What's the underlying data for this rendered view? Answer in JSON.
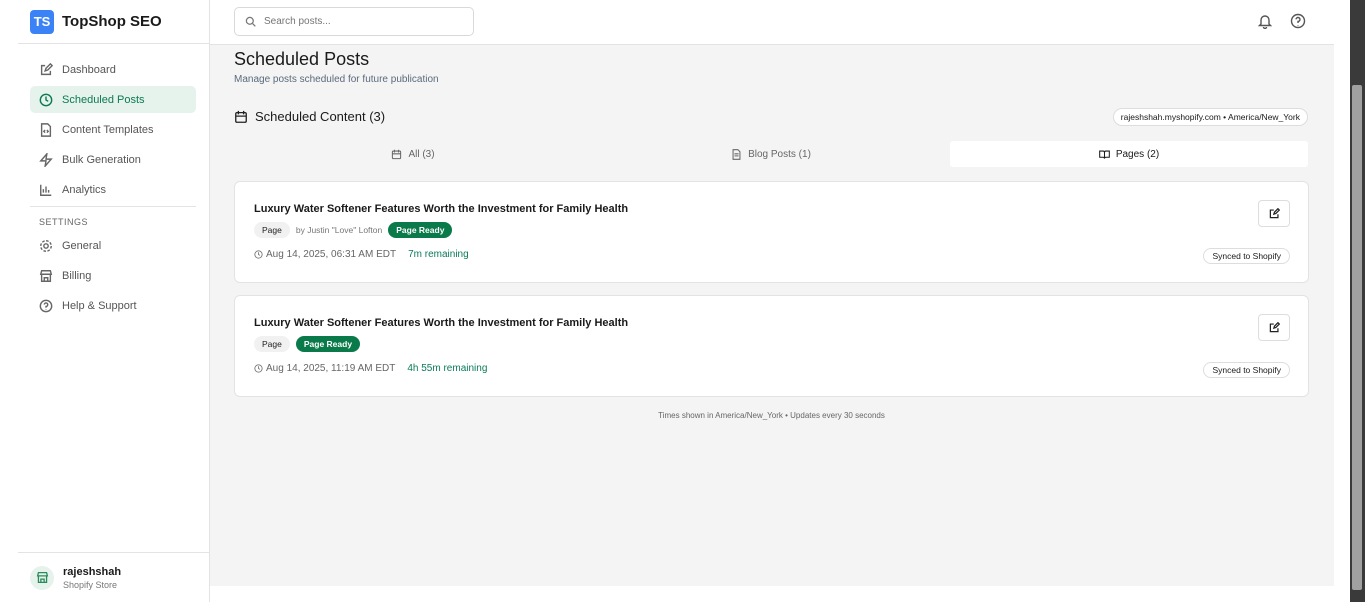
{
  "brand": {
    "logo": "TS",
    "name": "TopShop SEO"
  },
  "sidebar": {
    "items": [
      {
        "label": "Dashboard",
        "icon": "edit-icon"
      },
      {
        "label": "Scheduled Posts",
        "icon": "clock-icon",
        "active": true
      },
      {
        "label": "Content Templates",
        "icon": "file-code-icon"
      },
      {
        "label": "Bulk Generation",
        "icon": "zap-icon"
      },
      {
        "label": "Analytics",
        "icon": "bar-chart-icon"
      }
    ],
    "settings_label": "SETTINGS",
    "settings_items": [
      {
        "label": "General",
        "icon": "gear-icon"
      },
      {
        "label": "Billing",
        "icon": "store-icon"
      },
      {
        "label": "Help & Support",
        "icon": "help-icon"
      }
    ],
    "user": {
      "name": "rajeshshah",
      "subtitle": "Shopify Store"
    }
  },
  "search": {
    "placeholder": "Search posts..."
  },
  "page": {
    "title": "Scheduled Posts",
    "subtitle": "Manage posts scheduled for future publication",
    "section_title": "Scheduled Content (3)",
    "store_badge": "rajeshshah.myshopify.com • America/New_York",
    "tabs": [
      {
        "label": "All (3)"
      },
      {
        "label": "Blog Posts (1)"
      },
      {
        "label": "Pages (2)",
        "active": true
      }
    ],
    "posts": [
      {
        "title": "Luxury Water Softener Features Worth the Investment for Family Health",
        "type": "Page",
        "author": "by Justin \"Love\" Lofton",
        "status": "Page Ready",
        "date": "Aug 14, 2025, 06:31 AM EDT",
        "remaining": "7m remaining",
        "sync": "Synced to Shopify"
      },
      {
        "title": "Luxury Water Softener Features Worth the Investment for Family Health",
        "type": "Page",
        "status": "Page Ready",
        "date": "Aug 14, 2025, 11:19 AM EDT",
        "remaining": "4h 55m remaining",
        "sync": "Synced to Shopify"
      }
    ],
    "footer": "Times shown in America/New_York • Updates every 30 seconds"
  },
  "colors": {
    "accent": "#0b7a4b",
    "logo": "#3b82f6",
    "active_bg": "#e6f2ec"
  }
}
